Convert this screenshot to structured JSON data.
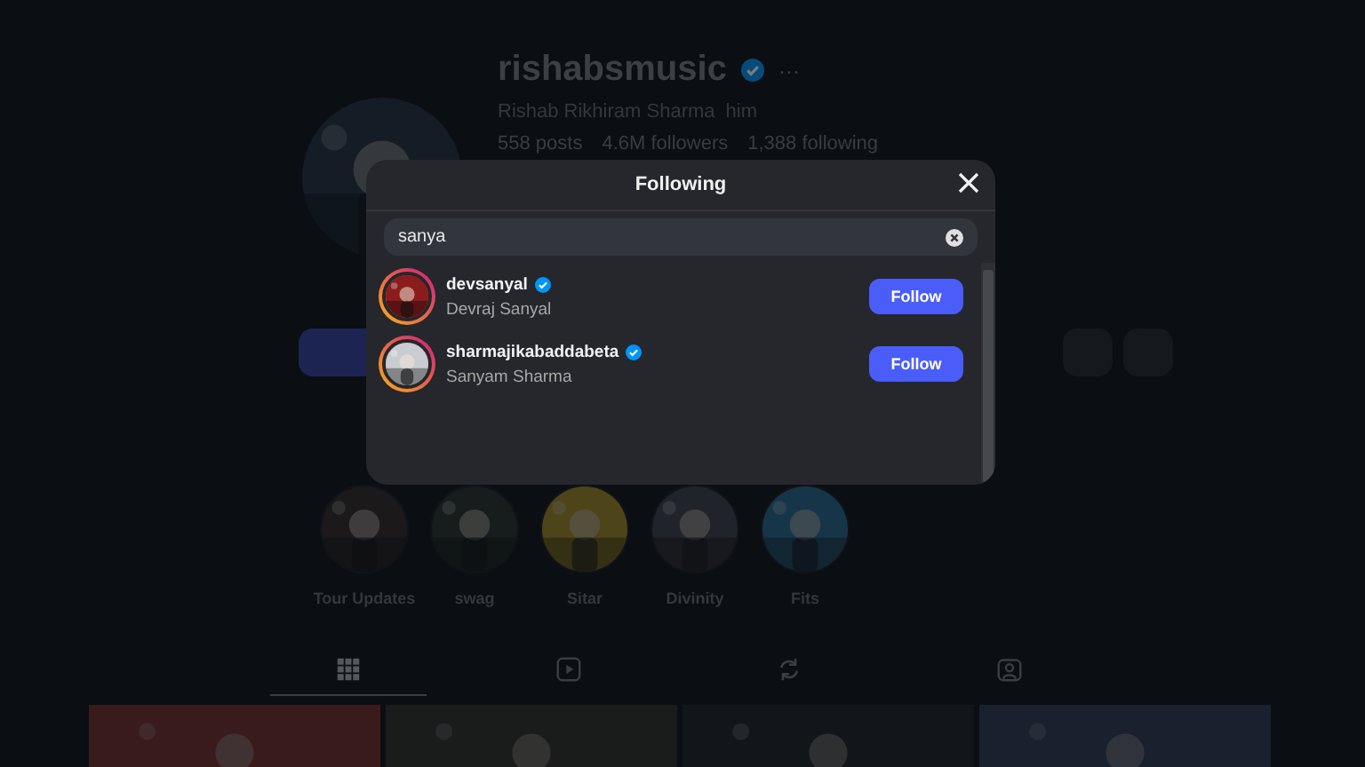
{
  "profile": {
    "username": "rishabsmusic",
    "verified": true,
    "more": "···",
    "name": "Rishab Rikhiram Sharma",
    "pronouns": "him",
    "stats": [
      "558 posts",
      "4.6M followers",
      "1,388 following"
    ]
  },
  "highlights": [
    {
      "label": "Tour Updates"
    },
    {
      "label": "swag"
    },
    {
      "label": "Sitar"
    },
    {
      "label": "Divinity"
    },
    {
      "label": "Fits"
    }
  ],
  "profile_tabs": [
    {
      "kind": "grid",
      "selected": true
    },
    {
      "kind": "reels",
      "selected": false
    },
    {
      "kind": "reposts",
      "selected": false
    },
    {
      "kind": "tagged",
      "selected": false
    }
  ],
  "modal": {
    "title": "Following",
    "search": {
      "value": "sanya"
    },
    "results": [
      {
        "username": "devsanyal",
        "verified": true,
        "name": "Devraj Sanyal",
        "button": "Follow"
      },
      {
        "username": "sharmajikabaddabeta",
        "verified": true,
        "name": "Sanyam Sharma",
        "button": "Follow"
      }
    ]
  }
}
